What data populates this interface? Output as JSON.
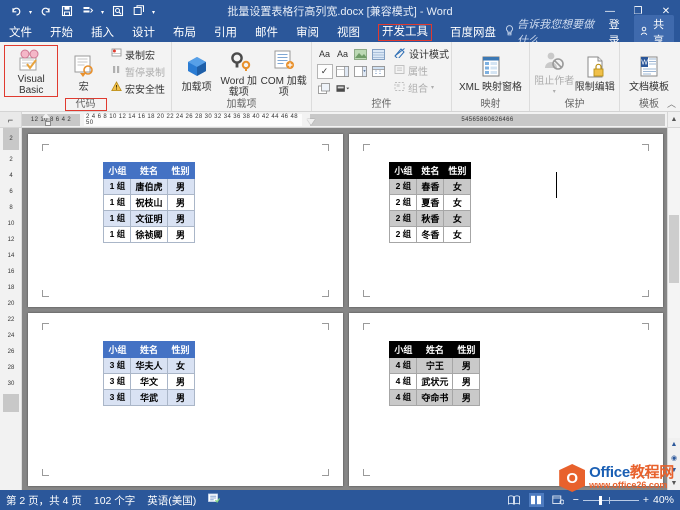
{
  "titlebar": {
    "document_title": "批量设置表格行高列宽.docx [兼容模式] - Word",
    "quick_access": [
      {
        "name": "undo-icon",
        "glyph": "↺"
      },
      {
        "name": "redo-icon",
        "glyph": "↻"
      },
      {
        "name": "save-icon",
        "glyph": "▤"
      },
      {
        "name": "touch-mode-icon",
        "glyph": "▤"
      },
      {
        "name": "print-preview-icon",
        "glyph": "⌕"
      },
      {
        "name": "customize-qat-icon",
        "glyph": "▦"
      }
    ],
    "window_controls": [
      {
        "name": "minimize-button",
        "glyph": "—"
      },
      {
        "name": "restore-button",
        "glyph": "❐"
      },
      {
        "name": "close-button",
        "glyph": "✕"
      }
    ]
  },
  "tabs": [
    {
      "label": "文件",
      "active": false
    },
    {
      "label": "开始",
      "active": false
    },
    {
      "label": "插入",
      "active": false
    },
    {
      "label": "设计",
      "active": false
    },
    {
      "label": "布局",
      "active": false
    },
    {
      "label": "引用",
      "active": false
    },
    {
      "label": "邮件",
      "active": false
    },
    {
      "label": "审阅",
      "active": false
    },
    {
      "label": "视图",
      "active": false
    },
    {
      "label": "开发工具",
      "active": true
    },
    {
      "label": "百度网盘",
      "active": false
    }
  ],
  "header_right": {
    "tell_me": "告诉我您想要做什么...",
    "tell_me_icon": "lightbulb-icon",
    "sign_in": "登录",
    "share": "共享",
    "share_icon": "person-share-icon"
  },
  "ribbon": {
    "groups": [
      {
        "title": "代码",
        "title_highlighted": true,
        "big_buttons": [
          {
            "label": "Visual Basic",
            "icon": "visual-basic-icon",
            "highlighted": true
          },
          {
            "label": "宏",
            "icon": "macro-icon",
            "highlighted": false
          }
        ],
        "small_buttons": [
          {
            "label": "录制宏",
            "icon": "record-macro-icon",
            "disabled": false
          },
          {
            "label": "暂停录制",
            "icon": "pause-recording-icon",
            "disabled": true
          },
          {
            "label": "宏安全性",
            "icon": "macro-security-icon",
            "disabled": false
          }
        ]
      },
      {
        "title": "加载项",
        "title_highlighted": false,
        "big_buttons": [
          {
            "label": "加载项",
            "icon": "add-ins-icon",
            "highlighted": false
          },
          {
            "label": "Word 加载项",
            "icon": "word-add-ins-icon",
            "highlighted": false
          },
          {
            "label": "COM 加载项",
            "icon": "com-add-ins-icon",
            "highlighted": false
          }
        ],
        "small_buttons": []
      },
      {
        "title": "控件",
        "title_highlighted": false,
        "control_cells": [
          "Aa",
          "Aa",
          "▭",
          "▦",
          "☑",
          "▤",
          "▥",
          "▣",
          "▧",
          "▰"
        ],
        "small_buttons": [
          {
            "label": "设计模式",
            "icon": "design-mode-icon",
            "disabled": false
          },
          {
            "label": "属性",
            "icon": "properties-icon",
            "disabled": true
          },
          {
            "label": "组合",
            "icon": "group-icon",
            "disabled": true
          }
        ]
      },
      {
        "title": "映射",
        "title_highlighted": false,
        "big_buttons": [
          {
            "label": "XML 映射窗格",
            "icon": "xml-mapping-pane-icon",
            "highlighted": false
          }
        ],
        "small_buttons": []
      },
      {
        "title": "保护",
        "title_highlighted": false,
        "big_buttons": [
          {
            "label": "阻止作者",
            "icon": "block-authors-icon",
            "highlighted": false,
            "disabled": true
          },
          {
            "label": "限制编辑",
            "icon": "restrict-editing-icon",
            "highlighted": false
          }
        ],
        "small_buttons": []
      },
      {
        "title": "模板",
        "title_highlighted": false,
        "big_buttons": [
          {
            "label": "文档模板",
            "icon": "document-template-icon",
            "highlighted": false
          }
        ],
        "small_buttons": []
      }
    ],
    "collapse_icon": "chevron-up-icon"
  },
  "rulers": {
    "corner_icon": "tab-stop-icon",
    "horizontal_left_labels": [
      "12",
      "10",
      "8",
      "6",
      "4",
      "2"
    ],
    "horizontal_right_labels": [
      "2",
      "4",
      "6",
      "8",
      "10",
      "12",
      "14",
      "16",
      "18",
      "20",
      "22",
      "24",
      "26",
      "28",
      "30",
      "32",
      "34",
      "36",
      "38",
      "40",
      "42",
      "44",
      "46",
      "48",
      "50"
    ],
    "horizontal_tail_labels": [
      "54",
      "56",
      "58",
      "60",
      "62",
      "64",
      "66"
    ],
    "vertical_labels": [
      "2",
      "2",
      "4",
      "6",
      "8",
      "10",
      "12",
      "14",
      "16",
      "18",
      "20",
      "22",
      "24",
      "26",
      "28",
      "30"
    ]
  },
  "document": {
    "pages": [
      {
        "page_label": "page-1",
        "style": "blue",
        "headers": [
          "小组",
          "姓名",
          "性别"
        ],
        "rows": [
          [
            "1 组",
            "唐伯虎",
            "男"
          ],
          [
            "1 组",
            "祝枝山",
            "男"
          ],
          [
            "1 组",
            "文征明",
            "男"
          ],
          [
            "1 组",
            "徐祯卿",
            "男"
          ]
        ]
      },
      {
        "page_label": "page-2",
        "style": "dark",
        "headers": [
          "小组",
          "姓名",
          "性别"
        ],
        "rows": [
          [
            "2 组",
            "春香",
            "女"
          ],
          [
            "2 组",
            "夏香",
            "女"
          ],
          [
            "2 组",
            "秋香",
            "女"
          ],
          [
            "2 组",
            "冬香",
            "女"
          ]
        ]
      },
      {
        "page_label": "page-3",
        "style": "blue",
        "headers": [
          "小组",
          "姓名",
          "性别"
        ],
        "rows": [
          [
            "3 组",
            "华夫人",
            "女"
          ],
          [
            "3 组",
            "华文",
            "男"
          ],
          [
            "3 组",
            "华武",
            "男"
          ]
        ]
      },
      {
        "page_label": "page-4",
        "style": "dark",
        "headers": [
          "小组",
          "姓名",
          "性别"
        ],
        "rows": [
          [
            "4 组",
            "宁王",
            "男"
          ],
          [
            "4 组",
            "武状元",
            "男"
          ],
          [
            "4 组",
            "夺命书",
            "男"
          ]
        ]
      }
    ]
  },
  "statusbar": {
    "page_info": "第 2 页，共 4 页",
    "word_count": "102 个字",
    "language": "英语(美国)",
    "proofing_icon": "proofing-errors-icon",
    "view_buttons": [
      {
        "name": "read-mode-button",
        "glyph": "▯",
        "selected": false
      },
      {
        "name": "print-layout-button",
        "glyph": "▤",
        "selected": true
      },
      {
        "name": "web-layout-button",
        "glyph": "▣",
        "selected": false
      }
    ],
    "zoom_out": "−",
    "zoom_in": "+",
    "zoom_level": "40%"
  },
  "watermark": {
    "logo_letter": "O",
    "title_prefix": "Office",
    "title_suffix": "教程网",
    "url": "www.office26.com"
  }
}
